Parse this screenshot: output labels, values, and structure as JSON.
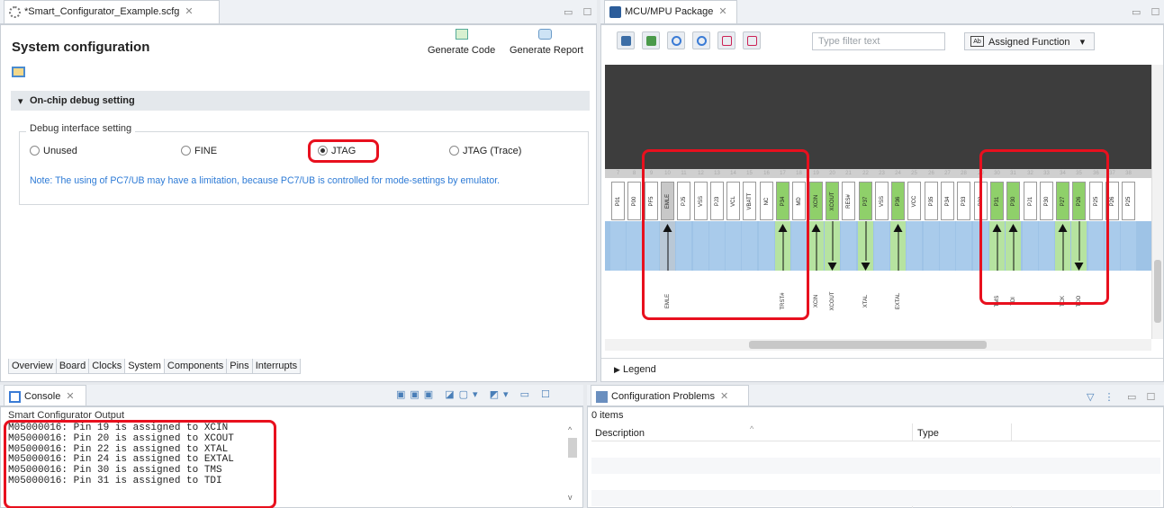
{
  "left": {
    "tab_title": "*Smart_Configurator_Example.scfg",
    "heading": "System configuration",
    "gen_code": "Generate Code",
    "gen_report": "Generate Report",
    "section": "On-chip debug setting",
    "group": "Debug interface setting",
    "options": [
      "Unused",
      "FINE",
      "JTAG",
      "JTAG (Trace)"
    ],
    "selected": "JTAG",
    "note": "Note: The using of PC7/UB may have a limitation, because PC7/UB is controlled for mode-settings by emulator.",
    "bottom_tabs": [
      "Overview",
      "Board",
      "Clocks",
      "System",
      "Components",
      "Pins",
      "Interrupts"
    ],
    "active_bottom_tab": "System"
  },
  "pkg": {
    "tab_title": "MCU/MPU Package",
    "filter_placeholder": "Type filter text",
    "assigned": "Assigned Function",
    "legend": "Legend",
    "pins": [
      {
        "n": "7",
        "name": "P01",
        "c": "w"
      },
      {
        "n": "8",
        "name": "P00",
        "c": "w"
      },
      {
        "n": "9",
        "name": "PF5",
        "c": "w"
      },
      {
        "n": "10",
        "name": "EMLE",
        "c": "g",
        "arrow": "up",
        "label": "EMLE"
      },
      {
        "n": "11",
        "name": "PJ5",
        "c": "w"
      },
      {
        "n": "12",
        "name": "VSS",
        "c": "w"
      },
      {
        "n": "13",
        "name": "PJ3",
        "c": "w"
      },
      {
        "n": "14",
        "name": "VCL",
        "c": "w"
      },
      {
        "n": "15",
        "name": "VBATT",
        "c": "w"
      },
      {
        "n": "16",
        "name": "NC",
        "c": "w"
      },
      {
        "n": "17",
        "name": "P34",
        "c": "G",
        "arrow": "up",
        "label": "TRST#"
      },
      {
        "n": "18",
        "name": "MD",
        "c": "w"
      },
      {
        "n": "19",
        "name": "XCIN",
        "c": "G",
        "arrow": "up",
        "label": "XCIN"
      },
      {
        "n": "20",
        "name": "XCOUT",
        "c": "G",
        "arrow": "down",
        "label": "XCOUT"
      },
      {
        "n": "21",
        "name": "RES#",
        "c": "w"
      },
      {
        "n": "22",
        "name": "P37",
        "c": "G",
        "arrow": "down",
        "label": "XTAL"
      },
      {
        "n": "23",
        "name": "VSS",
        "c": "w"
      },
      {
        "n": "24",
        "name": "P36",
        "c": "G",
        "arrow": "up",
        "label": "EXTAL"
      },
      {
        "n": "25",
        "name": "VCC",
        "c": "w"
      },
      {
        "n": "26",
        "name": "P35",
        "c": "w"
      },
      {
        "n": "27",
        "name": "P34",
        "c": "w"
      },
      {
        "n": "28",
        "name": "P33",
        "c": "w"
      },
      {
        "n": "29",
        "name": "P32",
        "c": "w"
      },
      {
        "n": "30",
        "name": "P31",
        "c": "G",
        "arrow": "up",
        "label": "TMS"
      },
      {
        "n": "31",
        "name": "P30",
        "c": "G",
        "arrow": "up",
        "label": "TDI"
      },
      {
        "n": "32",
        "name": "PJ1",
        "c": "w"
      },
      {
        "n": "33",
        "name": "P30",
        "c": "w"
      },
      {
        "n": "34",
        "name": "P27",
        "c": "G",
        "arrow": "up",
        "label": "TCK"
      },
      {
        "n": "35",
        "name": "P26",
        "c": "G",
        "arrow": "down",
        "label": "TDO"
      },
      {
        "n": "36",
        "name": "P25",
        "c": "w"
      },
      {
        "n": "37",
        "name": "P26",
        "c": "w"
      },
      {
        "n": "38",
        "name": "P25",
        "c": "w"
      }
    ]
  },
  "console": {
    "tab_title": "Console",
    "header": "Smart Configurator Output",
    "lines": [
      "M05000016: Pin 19 is assigned to XCIN",
      "M05000016: Pin 20 is assigned to XCOUT",
      "M05000016: Pin 22 is assigned to XTAL",
      "M05000016: Pin 24 is assigned to EXTAL",
      "M05000016: Pin 30 is assigned to TMS",
      "M05000016: Pin 31 is assigned to TDI"
    ]
  },
  "problems": {
    "tab_title": "Configuration Problems",
    "count": "0 items",
    "col_desc": "Description",
    "col_type": "Type"
  },
  "colors": {
    "accent": "#e8101e",
    "pin_green": "#8fd06a",
    "pin_blue": "#9ec3e6",
    "dark": "#3d3d3d"
  }
}
